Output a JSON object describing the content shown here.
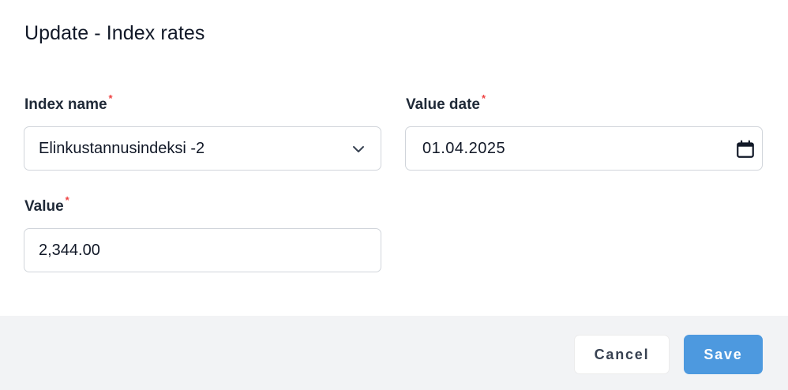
{
  "dialog": {
    "title": "Update - Index rates"
  },
  "form": {
    "index_name": {
      "label": "Index name",
      "required_mark": "*",
      "selected": "Elinkustannusindeksi -2"
    },
    "value_date": {
      "label": "Value date",
      "required_mark": "*",
      "value": "01.04.2025"
    },
    "value": {
      "label": "Value",
      "required_mark": "*",
      "value": "2,344.00"
    }
  },
  "footer": {
    "cancel_label": "Cancel",
    "save_label": "Save"
  },
  "icons": {
    "select": "chevron-down-icon",
    "date": "calendar-icon"
  },
  "colors": {
    "accent": "#4d99df",
    "required": "#ef4444",
    "footer_bg": "#f2f3f5",
    "border": "#d1d5db"
  }
}
